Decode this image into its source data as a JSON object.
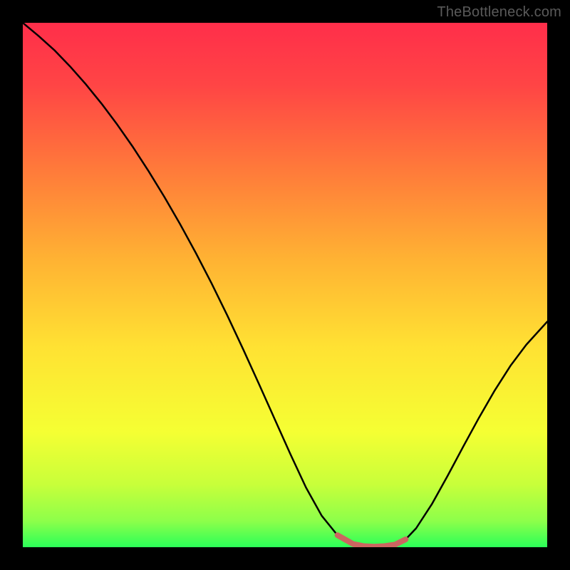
{
  "watermark": "TheBottleneck.com",
  "chart_data": {
    "type": "line",
    "title": "",
    "xlabel": "",
    "ylabel": "",
    "xlim": [
      0,
      100
    ],
    "ylim": [
      0,
      100
    ],
    "x": [
      0,
      3,
      6,
      9,
      12,
      15,
      18,
      21,
      24,
      27,
      30,
      33,
      36,
      39,
      42,
      45,
      48,
      51,
      54,
      57,
      60,
      63,
      65,
      67,
      69,
      71,
      73,
      75,
      78,
      81,
      84,
      87,
      90,
      93,
      96,
      100
    ],
    "values": [
      100,
      97.5,
      94.8,
      91.7,
      88.3,
      84.6,
      80.6,
      76.3,
      71.7,
      66.8,
      61.6,
      56.1,
      50.3,
      44.2,
      37.8,
      31.2,
      24.5,
      17.8,
      11.4,
      6.0,
      2.3,
      0.6,
      0.2,
      0.1,
      0.2,
      0.5,
      1.5,
      3.6,
      8.2,
      13.6,
      19.2,
      24.7,
      29.9,
      34.6,
      38.6,
      43.0
    ],
    "gradient_stops": [
      {
        "pct": 0,
        "color": "#ff2e4a"
      },
      {
        "pct": 12,
        "color": "#ff4545"
      },
      {
        "pct": 28,
        "color": "#ff7a3a"
      },
      {
        "pct": 45,
        "color": "#ffb233"
      },
      {
        "pct": 62,
        "color": "#ffe233"
      },
      {
        "pct": 78,
        "color": "#f5ff33"
      },
      {
        "pct": 88,
        "color": "#c8ff3a"
      },
      {
        "pct": 95,
        "color": "#8dff4a"
      },
      {
        "pct": 100,
        "color": "#2bff58"
      }
    ],
    "optimal_range": {
      "start_x": 60,
      "end_x": 73,
      "color": "#cc6560"
    }
  }
}
